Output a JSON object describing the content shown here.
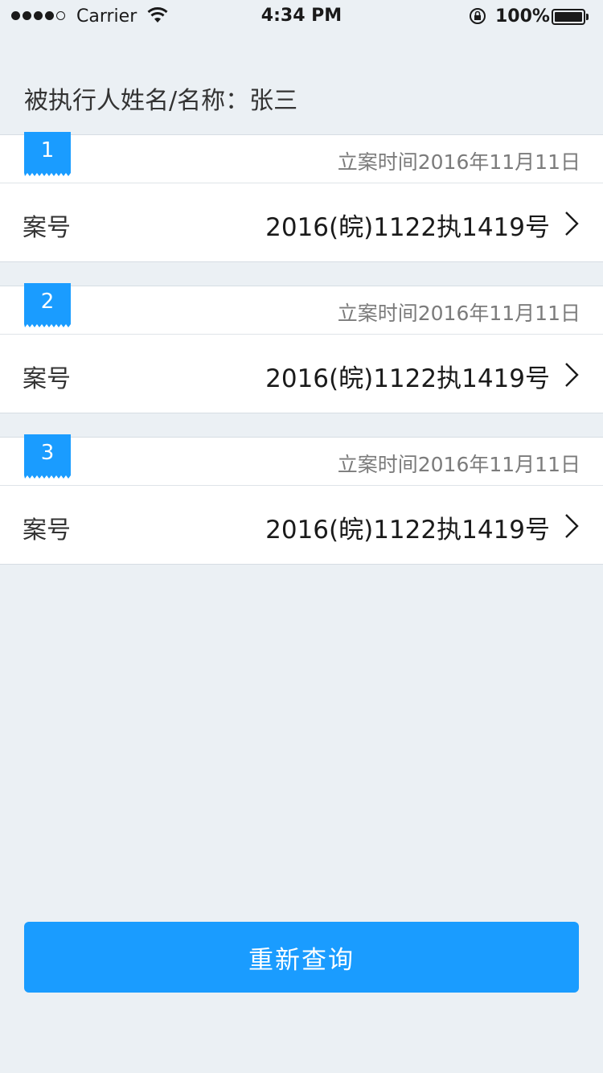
{
  "status_bar": {
    "carrier": "Carrier",
    "time": "4:34 PM",
    "battery": "100%"
  },
  "header": {
    "label": "被执行人姓名/名称：张三"
  },
  "cases": [
    {
      "index": "1",
      "filed_date": "立案时间2016年11月11日",
      "case_label": "案号",
      "case_number": "2016(皖)1122执1419号"
    },
    {
      "index": "2",
      "filed_date": "立案时间2016年11月11日",
      "case_label": "案号",
      "case_number": "2016(皖)1122执1419号"
    },
    {
      "index": "3",
      "filed_date": "立案时间2016年11月11日",
      "case_label": "案号",
      "case_number": "2016(皖)1122执1419号"
    }
  ],
  "actions": {
    "requery_label": "重新查询"
  },
  "colors": {
    "accent": "#1a9cff",
    "background": "#ebf0f4"
  }
}
